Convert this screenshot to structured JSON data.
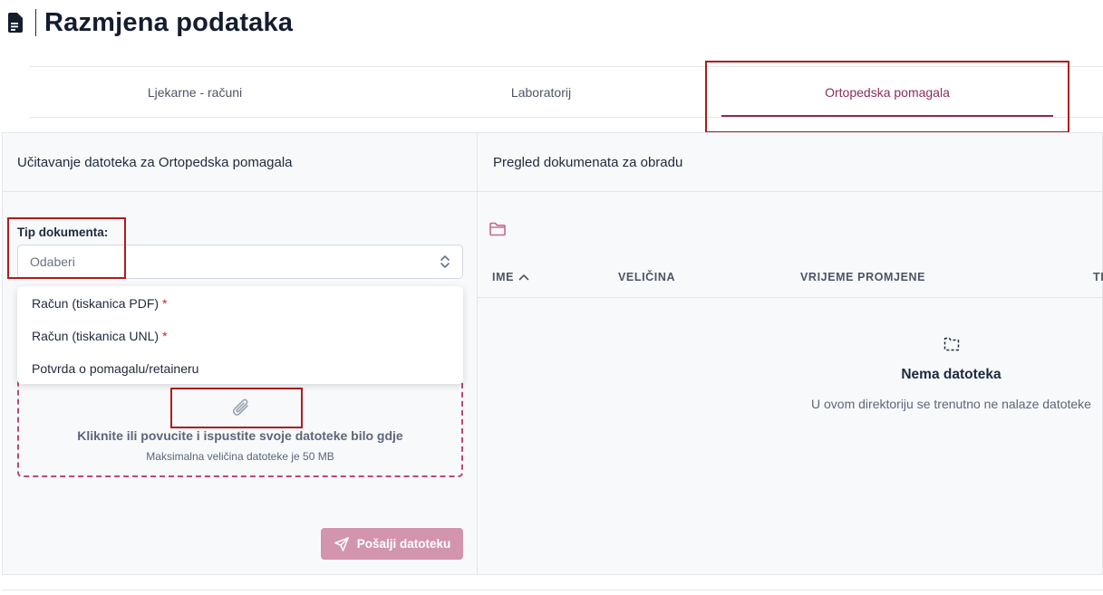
{
  "page": {
    "title": "Razmjena podataka",
    "icon": "document-icon"
  },
  "tabs": [
    {
      "label": "Ljekarne - računi",
      "active": false
    },
    {
      "label": "Laboratorij",
      "active": false
    },
    {
      "label": "Ortopedska pomagala",
      "active": true
    }
  ],
  "colors": {
    "accent": "#8b2c5a",
    "dropzone_border": "#b9487a",
    "send_button": "#d394ae",
    "required": "#d0222f",
    "highlight": "#b01c1c"
  },
  "upload_panel": {
    "title": "Učitavanje datoteka za Ortopedska pomagala",
    "field_label": "Tip dokumenta:",
    "select_placeholder": "Odaberi",
    "options": [
      {
        "label": "Račun (tiskanica PDF)",
        "required_mark": "*"
      },
      {
        "label": "Račun (tiskanica UNL)",
        "required_mark": "*"
      },
      {
        "label": "Potvrda o pomagalu/retaineru",
        "required_mark": ""
      }
    ],
    "dropzone_text": "Kliknite ili povucite i ispustite svoje datoteke bilo gdje",
    "dropzone_subtext": "Maksimalna veličina datoteke je 50 MB",
    "send_button": "Pošalji datoteku"
  },
  "review_panel": {
    "title": "Pregled dokumenata za obradu",
    "columns": [
      "IME",
      "VELIČINA",
      "VRIJEME PROMJENE",
      "TI"
    ],
    "sort_column": "IME",
    "sort_direction": "ascending",
    "empty_title": "Nema datoteka",
    "empty_subtitle": "U ovom direktoriju se trenutno ne nalaze datoteke"
  }
}
